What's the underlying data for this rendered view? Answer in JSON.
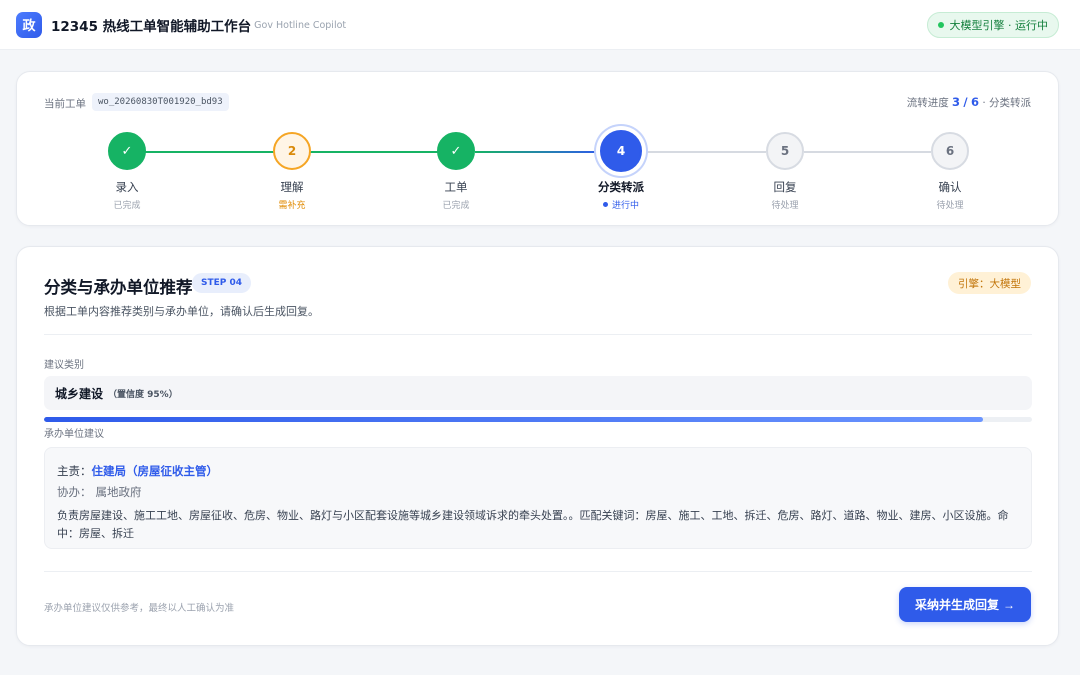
{
  "header": {
    "logo_char": "政",
    "title": "12345 热线工单智能辅助工作台",
    "subtitle": "Gov Hotline Copilot",
    "engine_status": "大模型引擎 · 运行中"
  },
  "progress": {
    "ticket_label": "当前工单",
    "ticket_id": "wo_20260830T001920_bd93",
    "flow_prefix": "流转进度",
    "flow_current": "3",
    "flow_separator": "/",
    "flow_total": "6",
    "flow_suffix": "· 分类转派",
    "steps": [
      {
        "mark": "✓",
        "name": "录入",
        "status": "已完成",
        "state": "done"
      },
      {
        "mark": "2",
        "name": "理解",
        "status": "需补充",
        "state": "warn"
      },
      {
        "mark": "✓",
        "name": "工单",
        "status": "已完成",
        "state": "done"
      },
      {
        "mark": "4",
        "name": "分类转派",
        "status": "进行中",
        "state": "active"
      },
      {
        "mark": "5",
        "name": "回复",
        "status": "待处理",
        "state": "pending"
      },
      {
        "mark": "6",
        "name": "确认",
        "status": "待处理",
        "state": "pending"
      }
    ]
  },
  "main": {
    "title": "分类与承办单位推荐",
    "step_badge": "STEP 04",
    "engine_badge": "引擎：大模型",
    "description": "根据工单内容推荐类别与承办单位，请确认后生成回复。",
    "category_label": "建议类别",
    "category_name": "城乡建设",
    "category_confidence_text": "（置信度 95%）",
    "category_confidence": 0.95,
    "unit_label": "承办单位建议",
    "lead_key": "主责：",
    "lead_value": "住建局（房屋征收主管）",
    "assist_key": "协办：",
    "assist_value": "属地政府",
    "unit_description": "负责房屋建设、施工工地、房屋征收、危房、物业、路灯与小区配套设施等城乡建设领域诉求的牵头处置。。匹配关键词：房屋、施工、工地、拆迁、危房、路灯、道路、物业、建房、小区设施。命中：房屋、拆迁",
    "footer_note": "承办单位建议仅供参考，最终以人工确认为准",
    "adopt_button": "采纳并生成回复",
    "adopt_arrow": "→"
  },
  "colors": {
    "accent": "#2f5bea",
    "done": "#16b364",
    "warn": "#f5a524",
    "engine_ok": "#22c55e"
  }
}
